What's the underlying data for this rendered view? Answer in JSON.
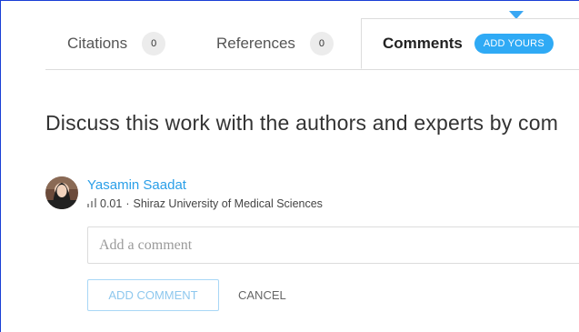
{
  "tabs": [
    {
      "label": "Citations",
      "count": "0"
    },
    {
      "label": "References",
      "count": "0"
    },
    {
      "label": "Comments",
      "action": "ADD YOURS"
    }
  ],
  "discussion": {
    "heading": "Discuss this work with the authors and experts by com"
  },
  "user": {
    "name": "Yasamin Saadat",
    "score": "0.01",
    "affiliation": "Shiraz University of Medical Sciences",
    "meta_separator": "·",
    "score_icon": "bar-chart-icon"
  },
  "comment_form": {
    "placeholder": "Add a comment",
    "value": "",
    "submit_label": "ADD COMMENT",
    "cancel_label": "CANCEL"
  },
  "colors": {
    "accent": "#2faaf5",
    "link": "#2a9fe8",
    "frame": "#1a3fd6"
  }
}
